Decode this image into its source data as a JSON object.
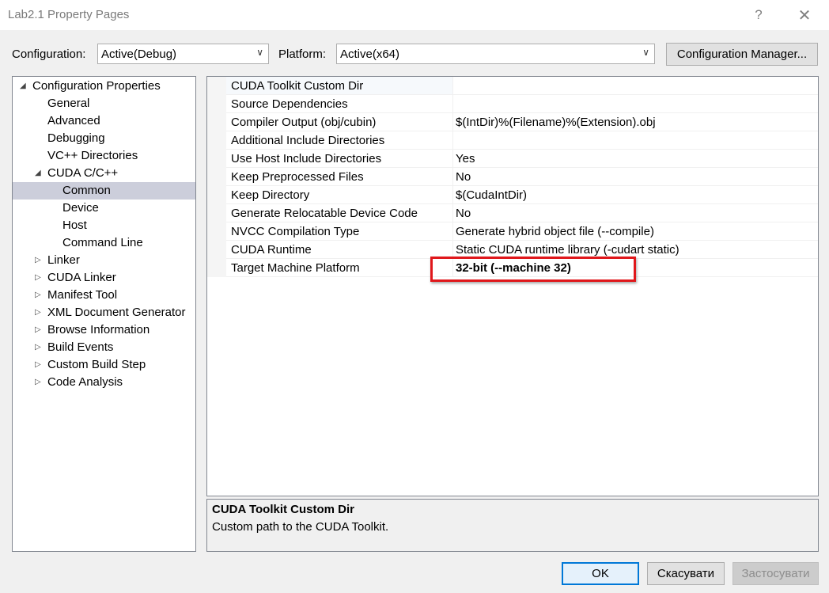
{
  "window": {
    "title": "Lab2.1 Property Pages",
    "help": "?",
    "close": "✕"
  },
  "config": {
    "label": "Configuration:",
    "value": "Active(Debug)"
  },
  "platform": {
    "label": "Platform:",
    "value": "Active(x64)"
  },
  "config_manager": "Configuration Manager...",
  "tree": {
    "items": [
      "Configuration Properties",
      "General",
      "Advanced",
      "Debugging",
      "VC++ Directories",
      "CUDA C/C++",
      "Common",
      "Device",
      "Host",
      "Command Line",
      "Linker",
      "CUDA Linker",
      "Manifest Tool",
      "XML Document Generator",
      "Browse Information",
      "Build Events",
      "Custom Build Step",
      "Code Analysis"
    ]
  },
  "properties": [
    {
      "name": "CUDA Toolkit Custom Dir",
      "value": ""
    },
    {
      "name": "Source Dependencies",
      "value": ""
    },
    {
      "name": "Compiler Output (obj/cubin)",
      "value": "$(IntDir)%(Filename)%(Extension).obj"
    },
    {
      "name": "Additional Include Directories",
      "value": ""
    },
    {
      "name": "Use Host Include Directories",
      "value": "Yes"
    },
    {
      "name": "Keep Preprocessed Files",
      "value": "No"
    },
    {
      "name": "Keep Directory",
      "value": "$(CudaIntDir)"
    },
    {
      "name": "Generate Relocatable Device Code",
      "value": "No"
    },
    {
      "name": "NVCC Compilation Type",
      "value": "Generate hybrid object file (--compile)"
    },
    {
      "name": "CUDA Runtime",
      "value": "Static CUDA runtime library (-cudart static)"
    },
    {
      "name": "Target Machine Platform",
      "value": "32-bit (--machine 32)"
    }
  ],
  "description": {
    "title": "CUDA Toolkit Custom Dir",
    "text": "Custom path to the CUDA Toolkit."
  },
  "buttons": {
    "ok": "OK",
    "cancel": "Скасувати",
    "apply": "Застосувати"
  },
  "colors": {
    "highlight": "#e0171b",
    "selection": "#cccedb",
    "primary_border": "#0078d7"
  }
}
